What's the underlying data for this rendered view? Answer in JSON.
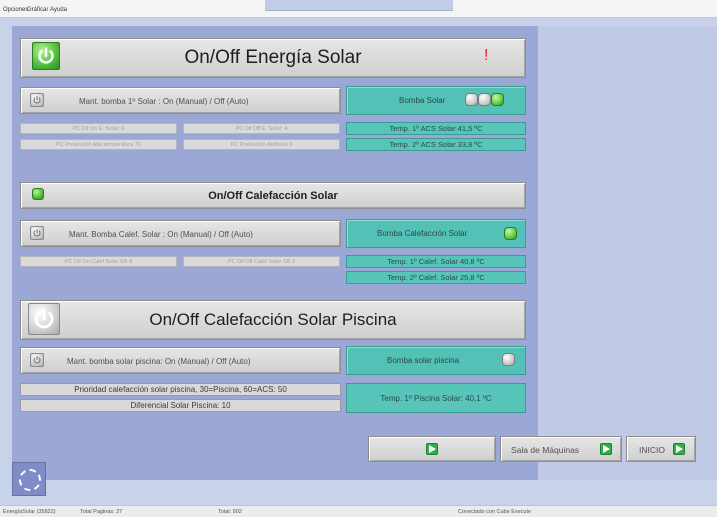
{
  "menu": {
    "items": [
      "Opciones",
      "Gráficar",
      "Ayuda"
    ]
  },
  "solar": {
    "title": "On/Off Energía Solar",
    "alert": "!",
    "mant_label": "Mant. bomba 1º Solar : On (Manual) / Off (Auto)",
    "pump_label": "Bomba Solar",
    "pc_on": "PC Dif On E. Solar: 6",
    "pc_off": "PC Dif Off E. Solar: 4",
    "pc_high": "PC Protección Alta temperatura 70",
    "pc_freeze": "PC Protección Antihielo 9",
    "temp1": "Temp. 1º ACS Solar 41,5 ºC",
    "temp2": "Temp. 2º ACS Solar 33,8 ºC"
  },
  "heating": {
    "title": "On/Off Calefacción Solar",
    "mant_label": "Mant. Bomba Calef. Solar : On (Manual) / Off (Auto)",
    "pump_label": "Bomba Calefacción Solar",
    "pc_on": "PC Dif On Calef Solar SR 4",
    "pc_off": "PC Dif Off Calef Solar SR 2",
    "temp1": "Temp. 1º Calef. Solar 40,8 ºC",
    "temp2": "Temp. 2º Calef. Solar 25,8 ºC"
  },
  "pool": {
    "title": "On/Off Calefacción Solar Piscina",
    "mant_label": "Mant. bomba solar piscina: On (Manual) / Off (Auto)",
    "pump_label": "Bomba solar piscina",
    "priority": "Prioridad calefacción solar piscina, 30=Piscina, 60=ACS: 50",
    "differential": "Diferencial Solar Piscina: 10",
    "temp1": "Temp. 1º Piscina Solar: 40,1 ºC"
  },
  "nav": {
    "machine_room": "Sala de Máquinas",
    "home": "INICIO"
  },
  "status": {
    "app": "EnergíaSolar (35822)",
    "total_pages": "Total Paginas: 37",
    "total": "Total: 902",
    "connection": "Conectado con Cube Execute"
  },
  "colors": {
    "panel": "#9ba8d6",
    "teal": "#53c1b6",
    "green": "#4cbf3a",
    "alert": "#e02020"
  }
}
